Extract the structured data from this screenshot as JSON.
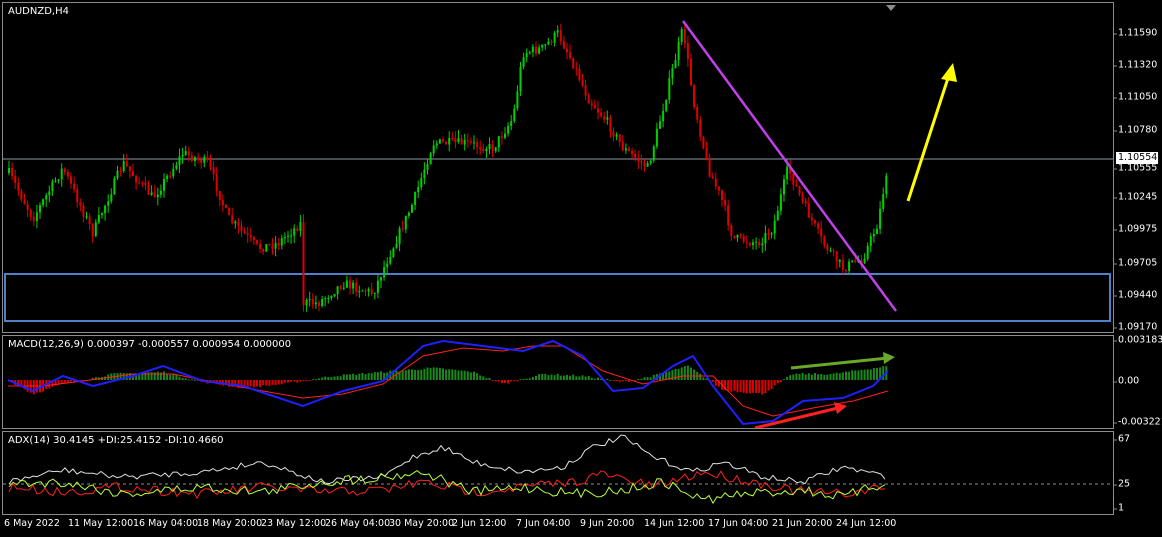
{
  "main": {
    "label": "AUDNZD,H4",
    "y_ticks": [
      "1.11590",
      "1.11320",
      "1.11050",
      "1.10780",
      "1.10555",
      "1.10245",
      "1.09975",
      "1.09705",
      "1.09440",
      "1.09170"
    ],
    "price_tag": "1.10554",
    "bull_color": "#00d200",
    "bear_color": "#e00000",
    "trendline_color": "#c040e8",
    "arrow_color": "#ffff00",
    "zone_color": "#4f80c8"
  },
  "macd": {
    "label": "MACD(12,26,9) 0.000397 -0.000557 0.000954 0.000000",
    "y_ticks": [
      "0.003183",
      "0.00",
      "-0.003221"
    ],
    "main_line_color": "#2020ff",
    "signal_line_color": "#ff2020",
    "hist_up_color": "#1a8a1a",
    "hist_down_color": "#e00000"
  },
  "adx": {
    "label": "ADX(14) 30.4145 +DI:25.4152 -DI:10.4660",
    "y_ticks": [
      "67",
      "25",
      "1"
    ]
  },
  "x_ticks": [
    "6 May 2022",
    "11 May 12:00",
    "16 May 04:00",
    "18 May 20:00",
    "23 May 12:00",
    "26 May 04:00",
    "30 May 20:00",
    "2 Jun 12:00",
    "7 Jun 04:00",
    "9 Jun 20:00",
    "14 Jun 12:00",
    "17 Jun 04:00",
    "21 Jun 20:00",
    "24 Jun 12:00"
  ]
}
